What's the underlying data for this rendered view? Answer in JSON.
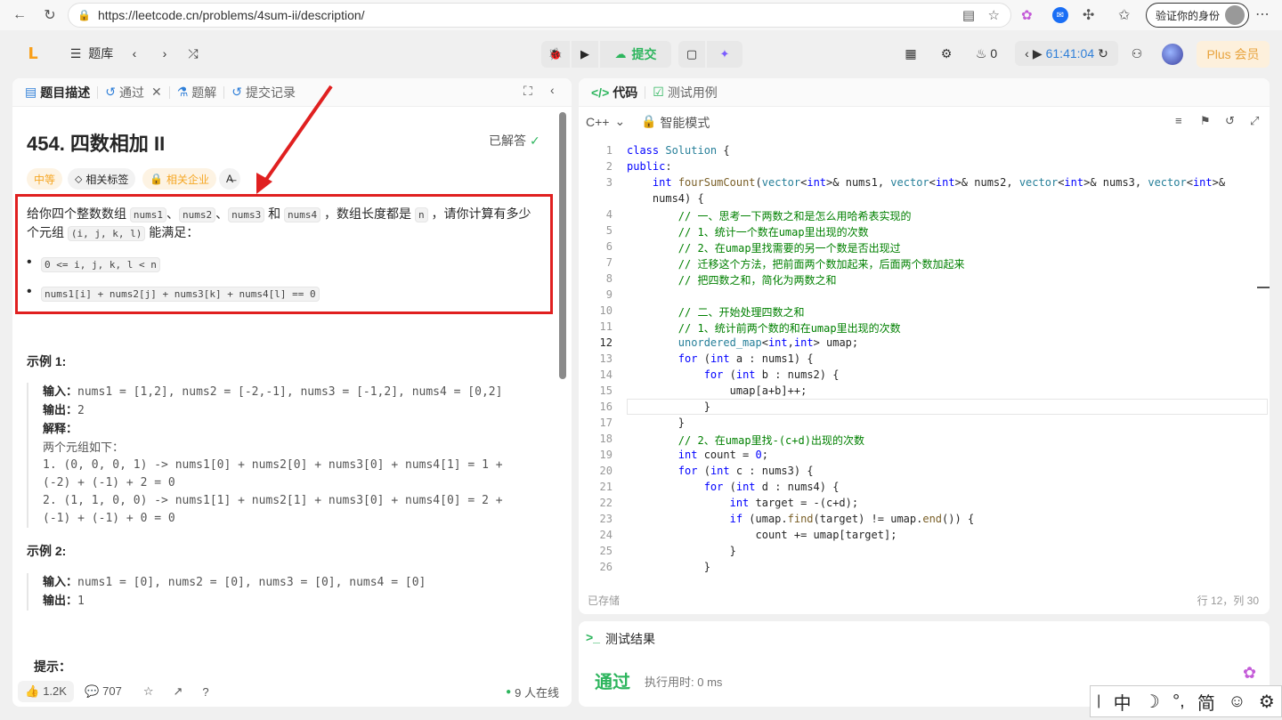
{
  "browser": {
    "url": "https://leetcode.cn/problems/4sum-ii/description/",
    "verify_label": "验证你的身份"
  },
  "nav": {
    "problem_list_label": "题库",
    "submit_label": "提交",
    "streak_count": "0",
    "timer": "61:41:04",
    "plus_label": "Plus 会员"
  },
  "left_tabs": {
    "description": "题目描述",
    "passed": "通过",
    "solutions": "题解",
    "submissions": "提交记录"
  },
  "problem": {
    "title": "454. 四数相加 II",
    "status": "已解答",
    "difficulty": "中等",
    "tags_label": "相关标签",
    "companies_label": "相关企业",
    "desc_p1_a": "给你四个整数数组 ",
    "nums1": "nums1",
    "sep1": "、",
    "nums2": "nums2",
    "sep2": "、",
    "nums3": "nums3",
    "and_text": " 和 ",
    "nums4": "nums4",
    "desc_p1_b": " ，数组长度都是 ",
    "n": "n",
    "desc_p1_c": " ，请你计算有多少",
    "desc_p2_a": "个元组 ",
    "tuple": "(i, j, k, l)",
    "desc_p2_b": " 能满足：",
    "bullet1": "0 <= i, j, k, l < n",
    "bullet2": "nums1[i] + nums2[j] + nums3[k] + nums4[l] == 0",
    "example1_title": "示例 1:",
    "ex1_input_label": "输入：",
    "ex1_input": "nums1 = [1,2], nums2 = [-2,-1], nums3 = [-1,2], nums4 = [0,2]",
    "ex1_output_label": "输出：",
    "ex1_output": "2",
    "ex1_explain_label": "解释：",
    "ex1_line1": "两个元组如下：",
    "ex1_line2": "1. (0, 0, 0, 1) -> nums1[0] + nums2[0] + nums3[0] + nums4[1] = 1 +",
    "ex1_line3": "(-2) + (-1) + 2 = 0",
    "ex1_line4": "2. (1, 1, 0, 0) -> nums1[1] + nums2[1] + nums3[0] + nums4[0] = 2 +",
    "ex1_line5": "(-1) + (-1) + 0 = 0",
    "example2_title": "示例 2:",
    "ex2_input_label": "输入：",
    "ex2_input": "nums1 = [0], nums2 = [0], nums3 = [0], nums4 = [0]",
    "ex2_output_label": "输出：",
    "ex2_output": "1",
    "hint_title": "提示："
  },
  "left_footer": {
    "likes": "1.2K",
    "comments": "707",
    "online": "9 人在线"
  },
  "editor": {
    "tab_code": "代码",
    "tab_testcase": "测试用例",
    "language": "C++",
    "mode": "智能模式",
    "saved": "已存储",
    "position": "行 12，列 30",
    "lines": [
      "1",
      "2",
      "3",
      "",
      "4",
      "5",
      "6",
      "7",
      "8",
      "9",
      "10",
      "11",
      "12",
      "13",
      "14",
      "15",
      "16",
      "17",
      "18",
      "19",
      "20",
      "21",
      "22",
      "23",
      "24",
      "25",
      "26"
    ]
  },
  "results": {
    "title": "测试结果",
    "status": "通过",
    "runtime": "执行用时: 0 ms"
  },
  "ime": {
    "zh": "中",
    "simplified": "简"
  }
}
